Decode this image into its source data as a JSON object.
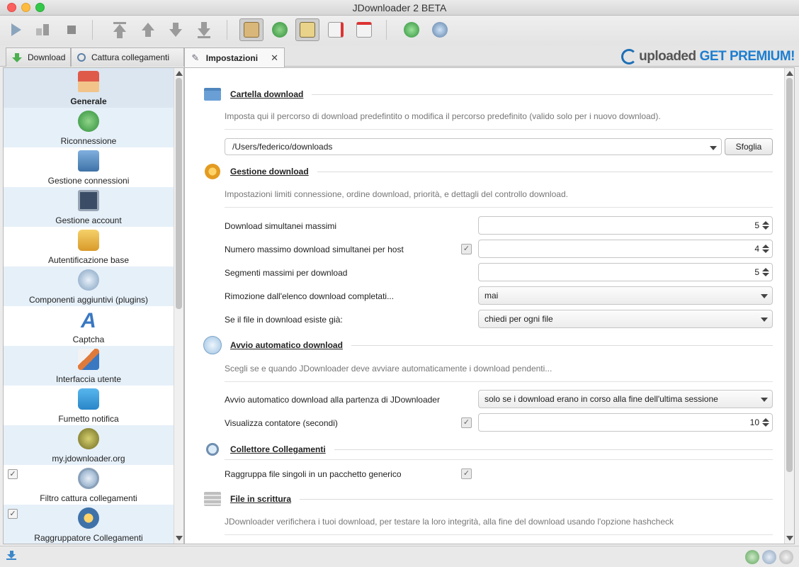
{
  "window": {
    "title": "JDownloader 2 BETA"
  },
  "toolbar": {
    "icons": [
      "play-icon",
      "pause-icon",
      "stop-icon",
      "move-top-icon",
      "move-up-icon",
      "move-down-icon",
      "move-bottom-icon",
      "clipboard-icon",
      "reconnect-icon",
      "auto-confirm-icon",
      "remove-icon",
      "shutdown-icon",
      "update-icon",
      "premium-icon"
    ]
  },
  "tabs": [
    {
      "label": "Download"
    },
    {
      "label": "Cattura collegamenti"
    },
    {
      "label": "Impostazioni",
      "active": true
    }
  ],
  "premium": {
    "brand": "uploaded",
    "cta": "GET PREMIUM!"
  },
  "sidebar": {
    "items": [
      {
        "label": "Generale",
        "icon": "home-icon",
        "selected": true
      },
      {
        "label": "Riconnessione",
        "icon": "reconnect-icon"
      },
      {
        "label": "Gestione connessioni",
        "icon": "network-icon"
      },
      {
        "label": "Gestione account",
        "icon": "monitor-lock-icon"
      },
      {
        "label": "Autentificazione base",
        "icon": "keys-icon"
      },
      {
        "label": "Componenti aggiuntivi (plugins)",
        "icon": "plugin-icon"
      },
      {
        "label": "Captcha",
        "icon": "captcha-icon"
      },
      {
        "label": "Interfaccia utente",
        "icon": "paint-icon"
      },
      {
        "label": "Fumetto notifica",
        "icon": "balloon-icon"
      },
      {
        "label": "my.jdownloader.org",
        "icon": "myjd-icon"
      },
      {
        "label": "Filtro cattura collegamenti",
        "icon": "filter-icon",
        "checkbox": true
      },
      {
        "label": "Raggruppatore Collegamenti",
        "icon": "packager-icon",
        "checkbox": true
      }
    ]
  },
  "main": {
    "cartella": {
      "title": "Cartella download",
      "desc": "Imposta qui il percorso di download predefintito o modifica il percorso predefinito (valido solo per i nuovo download).",
      "path": "/Users/federico/downloads",
      "browse": "Sfoglia"
    },
    "gestione": {
      "title": "Gestione download",
      "desc": "Impostazioni limiti connessione, ordine download, priorità, e dettagli del controllo download.",
      "max_sim_label": "Download simultanei massimi",
      "max_sim_value": "5",
      "per_host_label": "Numero massimo download simultanei per host",
      "per_host_value": "4",
      "segments_label": "Segmenti massimi per download",
      "segments_value": "5",
      "remove_label": "Rimozione dall'elenco download completati...",
      "remove_value": "mai",
      "exists_label": "Se il file in download esiste già:",
      "exists_value": "chiedi per ogni file"
    },
    "avvio": {
      "title": "Avvio automatico download",
      "desc": "Scegli se e quando JDownloader deve avviare automaticamente i download pendenti...",
      "start_label": "Avvio automatico download alla partenza di JDownloader",
      "start_value": "solo se i download erano in corso alla fine dell'ultima sessione",
      "counter_label": "Visualizza contatore (secondi)",
      "counter_value": "10"
    },
    "collettore": {
      "title": "Collettore Collegamenti",
      "group_label": "Raggruppa file singoli in un pacchetto generico"
    },
    "scrittura": {
      "title": "File in scrittura",
      "desc": "JDownloader verifichera i tuoi download, per testare la loro integrità, alla fine del download usando l'opzione hashcheck"
    }
  },
  "colors": {
    "accent": "#1d7ed0",
    "selected": "#dbe6f1",
    "alt_row": "#e6f0f9"
  }
}
